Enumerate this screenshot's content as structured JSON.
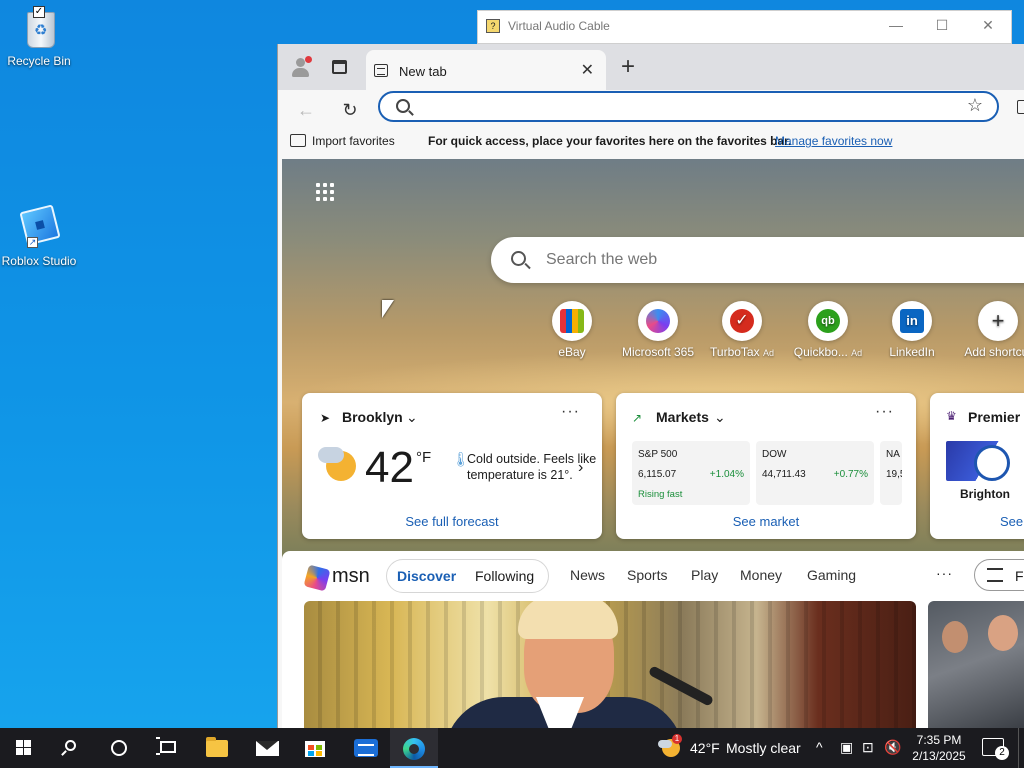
{
  "desktop": {
    "icons": [
      {
        "label": "Recycle Bin"
      },
      {
        "label": "Roblox Studio"
      }
    ]
  },
  "vac_window": {
    "title": "Virtual Audio Cable",
    "minimize": "—",
    "maximize": "☐",
    "close": "✕"
  },
  "browser": {
    "tab": {
      "title": "New tab",
      "close": "✕"
    },
    "new_tab": "+",
    "toolbar": {
      "back": "←",
      "refresh": "↻",
      "address_value": "",
      "star": "☆"
    },
    "favorites_bar": {
      "import": "Import favorites",
      "hint": "For quick access, place your favorites here on the favorites bar.",
      "manage_link": "Manage favorites now"
    }
  },
  "ntp": {
    "search_placeholder": "Search the web",
    "shortcuts": [
      {
        "label": "eBay",
        "ad": ""
      },
      {
        "label": "Microsoft 365",
        "ad": ""
      },
      {
        "label": "TurboTax",
        "ad": "Ad"
      },
      {
        "label": "Quickbo...",
        "ad": "Ad"
      },
      {
        "label": "LinkedIn",
        "ad": ""
      },
      {
        "label": "Add shortcut",
        "ad": ""
      }
    ],
    "add_shortcut_glyph": "+",
    "weather": {
      "location": "Brooklyn",
      "temp": "42",
      "unit": "°F",
      "description": "Cold outside. Feels like temperature is 21°.",
      "footer": "See full forecast"
    },
    "markets": {
      "title": "Markets",
      "tickers": [
        {
          "name": "S&P 500",
          "price": "6,115.07",
          "change": "+1.04%",
          "note": "Rising fast"
        },
        {
          "name": "DOW",
          "price": "44,711.43",
          "change": "+0.77%",
          "note": ""
        },
        {
          "name": "NA",
          "price": "19,5",
          "change": "",
          "note": ""
        }
      ],
      "footer": "See market"
    },
    "sports": {
      "title": "Premier L",
      "club": "Brighton",
      "footer": "See"
    },
    "feed": {
      "brand": "msn",
      "tabs": [
        "Discover",
        "Following"
      ],
      "nav": [
        "News",
        "Sports",
        "Play",
        "Money",
        "Gaming"
      ],
      "more": "···",
      "filter": "Fe"
    }
  },
  "taskbar": {
    "weather_temp": "42°F",
    "weather_condition": "Mostly clear",
    "weather_badge": "1",
    "time": "7:35 PM",
    "date": "2/13/2025",
    "notifications": "2"
  },
  "colors": {
    "accent": "#1a5fb4",
    "desktop": "#0f8fe3",
    "taskbar": "#1b1b1f",
    "positive": "#1b8f3b"
  }
}
